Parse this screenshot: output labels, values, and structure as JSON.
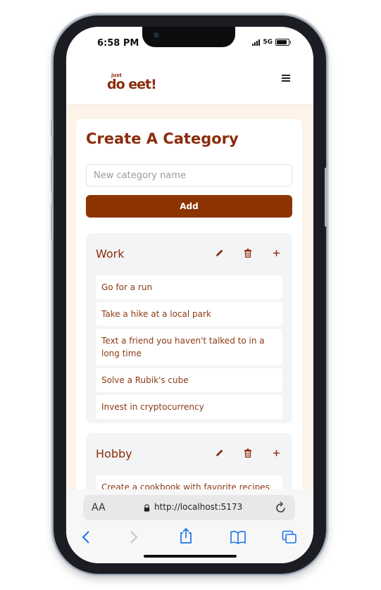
{
  "status": {
    "time": "6:58 PM",
    "network": "5G"
  },
  "app": {
    "logo_small": "just",
    "logo_big": "do eet!"
  },
  "page": {
    "title": "Create A Category",
    "input_placeholder": "New category name",
    "add_label": "Add"
  },
  "categories": [
    {
      "name": "Work",
      "tasks": [
        "Go for a run",
        "Take a hike at a local park",
        "Text a friend you haven't talked to in a long time",
        "Solve a Rubik's cube",
        "Invest in cryptocurrency"
      ]
    },
    {
      "name": "Hobby",
      "tasks": [
        "Create a cookbook with favorite recipes"
      ]
    }
  ],
  "browser": {
    "aa_label": "AA",
    "url": "http://localhost:5173"
  },
  "colors": {
    "brand": "#8b2c0c",
    "button": "#8b3402",
    "page_bg": "#fdf3e8",
    "category_bg": "#f3f4f6",
    "ios_blue": "#1a73e8"
  },
  "icons": {
    "edit": "pencil-icon",
    "delete": "trash-icon",
    "add_task": "plus-icon",
    "menu": "hamburger-menu-icon"
  }
}
